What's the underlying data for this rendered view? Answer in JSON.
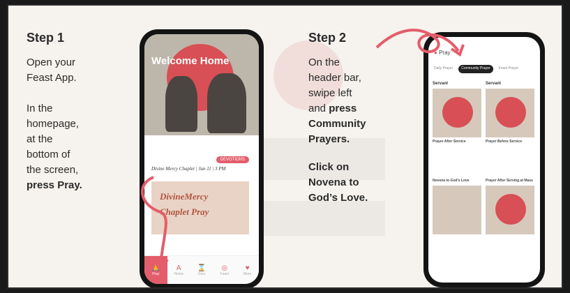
{
  "step1": {
    "title": "Step 1",
    "line1": "Open your",
    "line2": "Feast App.",
    "line3": "In the",
    "line4": "homepage,",
    "line5": "at the",
    "line6": "bottom of",
    "line7": "the screen,",
    "line8": "press Pray."
  },
  "step2": {
    "title": "Step 2",
    "line1": "On the",
    "line2": "header bar,",
    "line3": "swipe left",
    "line4": "and",
    "line4b": "press",
    "line5": "Community",
    "line6": "Prayers.",
    "line7": "Click on",
    "line8": "Novena to",
    "line9": "God’s Love."
  },
  "phone1": {
    "hero_title": "Welcome Home",
    "card_pill": "DEVOTIONS",
    "card_title": "Divine Mercy Chaplet | Jan 11 | 3 PM",
    "card_img_line1": "DivineMercy",
    "card_img_line2": "Chaplet Pray",
    "nav": [
      "Pray",
      "Home",
      "Give",
      "Feast",
      "More"
    ]
  },
  "phone2": {
    "header": "Pray",
    "tabs": [
      "Daily Prayer",
      "Community Prayer",
      "Feast Prayer"
    ],
    "col1_header": "Servant",
    "col2_header": "Servant",
    "cap1": "Prayer After Service",
    "cap2": "Prayer Before Service",
    "cap3": "Novena to God's Love",
    "cap4": "Prayer After Serving at Mass"
  },
  "colors": {
    "accent": "#e35d6a",
    "red": "#d84f55"
  }
}
